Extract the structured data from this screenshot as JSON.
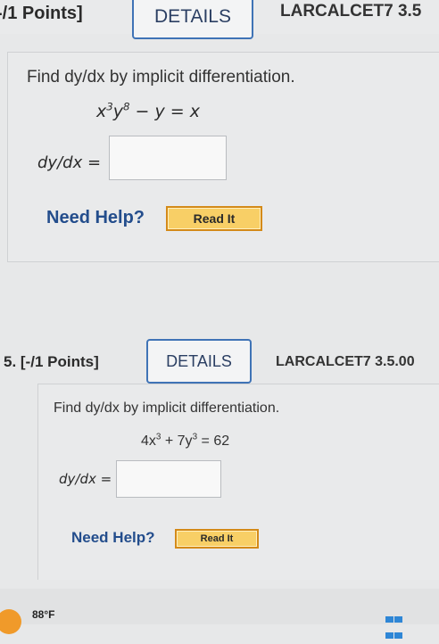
{
  "q4": {
    "points": "-/1 Points]",
    "details_label": "DETAILS",
    "code": "LARCALCET7 3.5",
    "prompt": "Find dy/dx by implicit differentiation.",
    "equation": {
      "lhs_base1": "x",
      "lhs_exp1": "3",
      "lhs_base2": "y",
      "lhs_exp2": "8",
      "rest": " − y = x"
    },
    "answer_label": "dy/dx  =",
    "answer_value": "",
    "need_help": "Need Help?",
    "read_it": "Read It"
  },
  "q5": {
    "points": "5.  [-/1 Points]",
    "details_label": "DETAILS",
    "code": "LARCALCET7 3.5.00",
    "prompt": "Find dy/dx by implicit differentiation.",
    "equation": {
      "c1": "4x",
      "e1": "3",
      "mid": " + 7y",
      "e2": "3",
      "rest": " = 62"
    },
    "answer_label": "dy/dx =",
    "answer_value": "",
    "need_help": "Need Help?",
    "read_it": "Read It"
  },
  "taskbar": {
    "temperature": "88°F",
    "weather_icon": "weather-icon",
    "windows_icon": "windows-icon"
  },
  "colors": {
    "details_border": "#3f73b6",
    "need_help": "#234d8c",
    "read_it_bg": "#f2b53d"
  }
}
